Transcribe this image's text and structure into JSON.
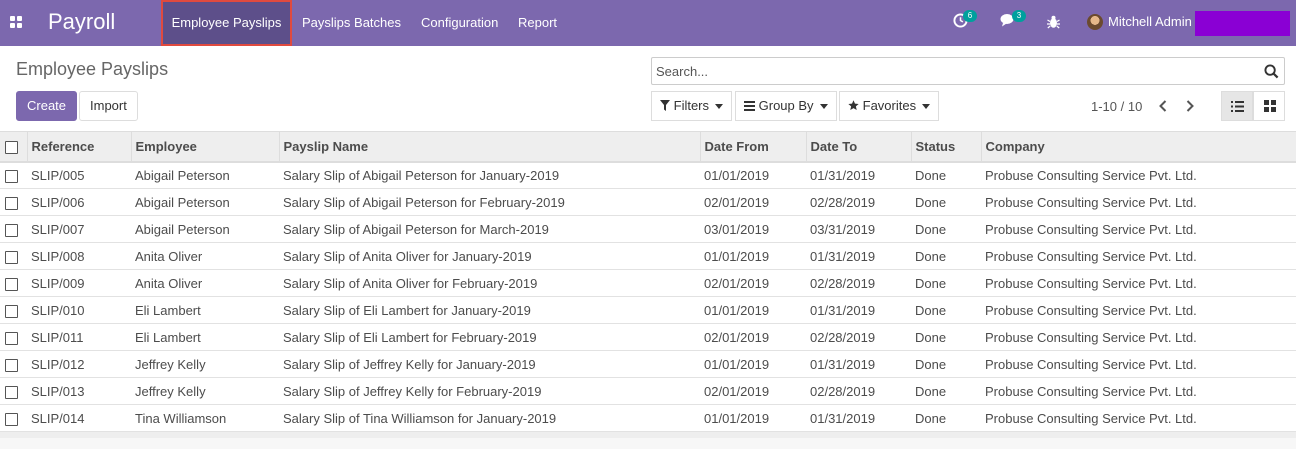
{
  "app": {
    "brand": "Payroll"
  },
  "menu": {
    "items": [
      "Employee Payslips",
      "Payslips Batches",
      "Configuration",
      "Report"
    ]
  },
  "systray": {
    "activity_count": "6",
    "messages_count": "3",
    "user_name": "Mitchell Admin"
  },
  "control_panel": {
    "title": "Employee Payslips",
    "create_label": "Create",
    "import_label": "Import",
    "search_placeholder": "Search...",
    "filters_label": "Filters",
    "groupby_label": "Group By",
    "favorites_label": "Favorites",
    "pager": "1-10 / 10"
  },
  "table": {
    "columns": [
      "Reference",
      "Employee",
      "Payslip Name",
      "Date From",
      "Date To",
      "Status",
      "Company"
    ],
    "rows": [
      [
        "SLIP/005",
        "Abigail Peterson",
        "Salary Slip of Abigail Peterson for January-2019",
        "01/01/2019",
        "01/31/2019",
        "Done",
        "Probuse Consulting Service Pvt. Ltd."
      ],
      [
        "SLIP/006",
        "Abigail Peterson",
        "Salary Slip of Abigail Peterson for February-2019",
        "02/01/2019",
        "02/28/2019",
        "Done",
        "Probuse Consulting Service Pvt. Ltd."
      ],
      [
        "SLIP/007",
        "Abigail Peterson",
        "Salary Slip of Abigail Peterson for March-2019",
        "03/01/2019",
        "03/31/2019",
        "Done",
        "Probuse Consulting Service Pvt. Ltd."
      ],
      [
        "SLIP/008",
        "Anita Oliver",
        "Salary Slip of Anita Oliver for January-2019",
        "01/01/2019",
        "01/31/2019",
        "Done",
        "Probuse Consulting Service Pvt. Ltd."
      ],
      [
        "SLIP/009",
        "Anita Oliver",
        "Salary Slip of Anita Oliver for February-2019",
        "02/01/2019",
        "02/28/2019",
        "Done",
        "Probuse Consulting Service Pvt. Ltd."
      ],
      [
        "SLIP/010",
        "Eli Lambert",
        "Salary Slip of Eli Lambert for January-2019",
        "01/01/2019",
        "01/31/2019",
        "Done",
        "Probuse Consulting Service Pvt. Ltd."
      ],
      [
        "SLIP/011",
        "Eli Lambert",
        "Salary Slip of Eli Lambert for February-2019",
        "02/01/2019",
        "02/28/2019",
        "Done",
        "Probuse Consulting Service Pvt. Ltd."
      ],
      [
        "SLIP/012",
        "Jeffrey Kelly",
        "Salary Slip of Jeffrey Kelly for January-2019",
        "01/01/2019",
        "01/31/2019",
        "Done",
        "Probuse Consulting Service Pvt. Ltd."
      ],
      [
        "SLIP/013",
        "Jeffrey Kelly",
        "Salary Slip of Jeffrey Kelly for February-2019",
        "02/01/2019",
        "02/28/2019",
        "Done",
        "Probuse Consulting Service Pvt. Ltd."
      ],
      [
        "SLIP/014",
        "Tina Williamson",
        "Salary Slip of Tina Williamson for January-2019",
        "01/01/2019",
        "01/31/2019",
        "Done",
        "Probuse Consulting Service Pvt. Ltd."
      ]
    ]
  },
  "colors": {
    "navbar": "#7c68ae",
    "active_menu": "#5d4f8a",
    "highlight_border": "#e04a3f",
    "badge": "#00a09d",
    "redaction": "#8a00d4"
  }
}
